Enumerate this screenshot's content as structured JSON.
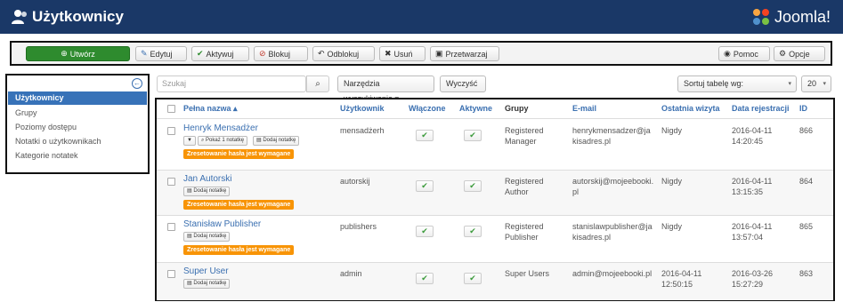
{
  "header": {
    "title": "Użytkownicy",
    "logo_text": "Joomla!",
    "bg_color": "#1a3867",
    "icons": {
      "title": "users-icon",
      "logo": "joomla-logo-icon"
    }
  },
  "toolbar": {
    "new_label": "Utwórz",
    "edit_label": "Edytuj",
    "publish_label": "Aktywuj",
    "block_label": "Blokuj",
    "unblock_label": "Odblokuj",
    "delete_label": "Usuń",
    "batch_label": "Przetwarzaj",
    "help_label": "Pomoc",
    "options_label": "Opcje",
    "new_color": "#2e8b2e"
  },
  "sidebar": {
    "items": [
      {
        "label": "Użytkownicy",
        "active": true
      },
      {
        "label": "Grupy"
      },
      {
        "label": "Poziomy dostępu"
      },
      {
        "label": "Notatki o użytkownikach"
      },
      {
        "label": "Kategorie notatek"
      }
    ],
    "active_color": "#3772b8"
  },
  "filters": {
    "search_placeholder": "Szukaj",
    "tools_label": "Narzędzia wyszukiwania ▾",
    "clear_label": "Wyczyść",
    "sort_label": "Sortuj tabelę wg:",
    "limit_label": "20"
  },
  "table": {
    "headers": {
      "name": "Pełna nazwa ▴",
      "username": "Użytkownik",
      "enabled": "Włączone",
      "activated": "Aktywne",
      "groups": "Grupy",
      "email": "E-mail",
      "last_visit": "Ostatnia wizyta",
      "registered": "Data rejestracji",
      "id": "ID"
    },
    "rows": [
      {
        "name": "Henryk Mensadżer",
        "username": "mensadżerh",
        "groups": "Registered Manager",
        "email": "henrykmensadzer@jakisadres.pl",
        "last_visit": "Nigdy",
        "registered": "2016-04-11 14:20:45",
        "id": "866",
        "show_notes": "Pokaż 1 notatkę",
        "add_note": "Dodaj notatkę",
        "warning": "Zresetowanie hasła jest wymagane"
      },
      {
        "name": "Jan Autorski",
        "username": "autorskij",
        "groups": "Registered Author",
        "email": "autorskij@mojeebooki.pl",
        "last_visit": "Nigdy",
        "registered": "2016-04-11 13:15:35",
        "id": "864",
        "add_note": "Dodaj notatkę",
        "warning": "Zresetowanie hasła jest wymagane"
      },
      {
        "name": "Stanisław Publisher",
        "username": "publishers",
        "groups": "Registered Publisher",
        "email": "stanislawpublisher@jakisadres.pl",
        "last_visit": "Nigdy",
        "registered": "2016-04-11 13:57:04",
        "id": "865",
        "add_note": "Dodaj notatkę",
        "warning": "Zresetowanie hasła jest wymagane"
      },
      {
        "name": "Super User",
        "username": "admin",
        "groups": "Super Users",
        "email": "admin@mojeebooki.pl",
        "last_visit": "2016-04-11 12:50:15",
        "registered": "2016-03-26 15:27:29",
        "id": "863",
        "add_note": "Dodaj notatkę"
      }
    ],
    "link_color": "#3a6fb0",
    "warning_color": "#f89406"
  }
}
